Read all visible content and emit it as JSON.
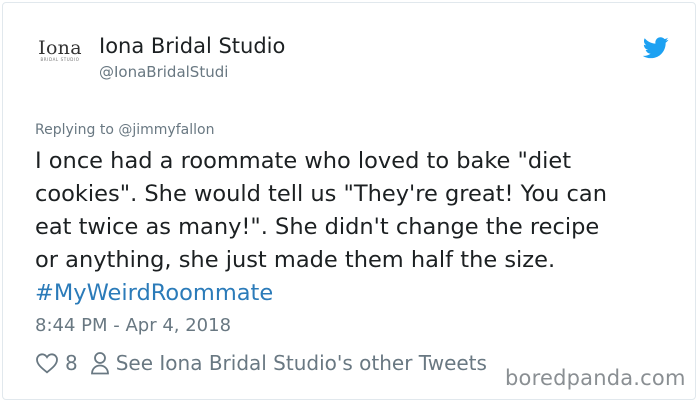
{
  "author": {
    "display_name": "Iona Bridal Studio",
    "handle": "@IonaBridalStudi",
    "avatar_logo_text": "Iona",
    "avatar_logo_subtext": "BRIDAL STUDIO"
  },
  "brand_icon": "twitter-bird-icon",
  "accent_color": "#1da1f2",
  "reply_context": "Replying to @jimmyfallon",
  "tweet": {
    "lines": [
      "I once had a roommate who loved to bake \"diet",
      "cookies\".  She would tell us \"They're great!  You can",
      "eat twice as many!\".  She didn't change the recipe",
      "or anything, she just made them half the size."
    ],
    "hashtag": "#MyWeirdRoommate"
  },
  "timestamp": "8:44 PM - Apr 4, 2018",
  "actions": {
    "like_icon": "heart-icon",
    "like_count": "8",
    "profile_icon": "person-icon",
    "profile_link": "See Iona Bridal Studio's other Tweets"
  },
  "watermark": "boredpanda.com"
}
